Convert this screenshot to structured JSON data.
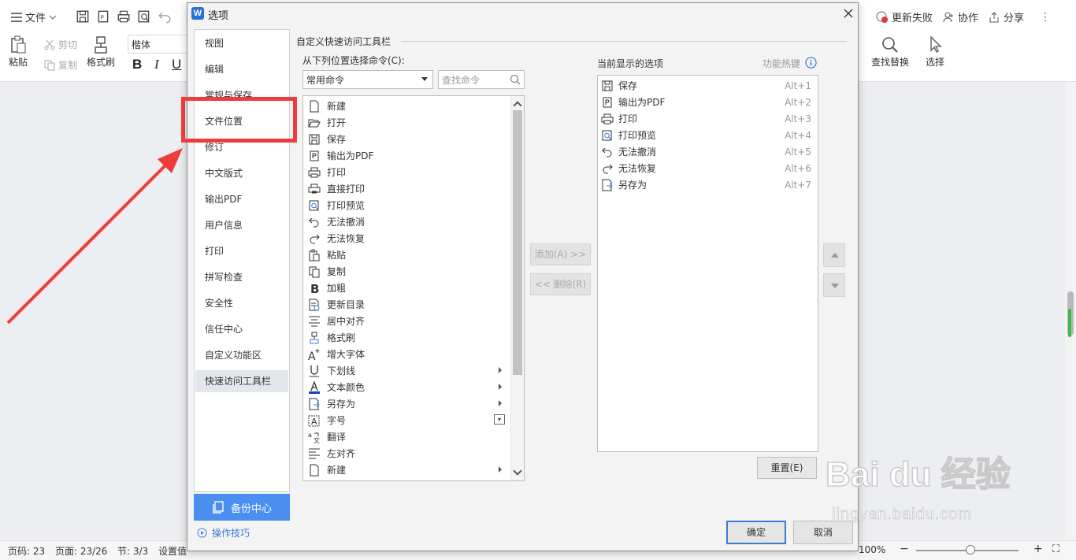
{
  "app": {
    "file_menu": "文件",
    "top_right": {
      "update_failed": "更新失败",
      "collaborate": "协作",
      "share": "分享"
    },
    "ribbon": {
      "paste": "粘贴",
      "cut": "剪切",
      "copy": "复制",
      "format_painter": "格式刷",
      "font_name": "楷体",
      "bold": "B",
      "italic": "I",
      "underline": "U",
      "find_replace": "查找替换",
      "select": "选择"
    },
    "statusbar": {
      "page_code": "页码: 23",
      "page": "页面: 23/26",
      "section": "节: 3/3",
      "setting": "设置值",
      "zoom": "100%"
    }
  },
  "dialog": {
    "title": "选项",
    "logo": "W",
    "nav_items": [
      "视图",
      "编辑",
      "常规与保存",
      "文件位置",
      "修订",
      "中文版式",
      "输出PDF",
      "用户信息",
      "打印",
      "拼写检查",
      "安全性",
      "信任中心",
      "自定义功能区",
      "快速访问工具栏"
    ],
    "selected_nav": "快速访问工具栏",
    "backup_center": "备份中心",
    "tips": "操作技巧",
    "section_title": "自定义快速访问工具栏",
    "from_label": "从下列位置选择命令(C):",
    "source_value": "常用命令",
    "search_placeholder": "查找命令",
    "commands": [
      {
        "label": "新建",
        "icon": "new-doc-icon"
      },
      {
        "label": "打开",
        "icon": "folder-open-icon"
      },
      {
        "label": "保存",
        "icon": "save-icon"
      },
      {
        "label": "输出为PDF",
        "icon": "pdf-export-icon"
      },
      {
        "label": "打印",
        "icon": "print-icon"
      },
      {
        "label": "直接打印",
        "icon": "direct-print-icon"
      },
      {
        "label": "打印预览",
        "icon": "print-preview-icon"
      },
      {
        "label": "无法撤消",
        "icon": "undo-icon"
      },
      {
        "label": "无法恢复",
        "icon": "redo-icon"
      },
      {
        "label": "粘贴",
        "icon": "paste-icon"
      },
      {
        "label": "复制",
        "icon": "copy-icon"
      },
      {
        "label": "加粗",
        "icon": "bold-icon"
      },
      {
        "label": "更新目录",
        "icon": "update-toc-icon"
      },
      {
        "label": "居中对齐",
        "icon": "align-center-icon"
      },
      {
        "label": "格式刷",
        "icon": "format-painter-icon"
      },
      {
        "label": "增大字体",
        "icon": "grow-font-icon"
      },
      {
        "label": "下划线",
        "icon": "underline-icon"
      },
      {
        "label": "文本颜色",
        "icon": "text-color-icon"
      },
      {
        "label": "另存为",
        "icon": "save-as-icon"
      },
      {
        "label": "字号",
        "icon": "font-size-icon"
      },
      {
        "label": "翻译",
        "icon": "translate-icon"
      },
      {
        "label": "左对齐",
        "icon": "align-left-icon"
      },
      {
        "label": "新建",
        "icon": "new-doc-icon"
      }
    ],
    "add_button": "添加(A) >>",
    "remove_button": "<< 删除(R)",
    "current_label": "当前显示的选项",
    "hotkey_label": "功能热键",
    "current_items": [
      {
        "label": "保存",
        "key": "Alt+1",
        "icon": "save-icon"
      },
      {
        "label": "输出为PDF",
        "key": "Alt+2",
        "icon": "pdf-export-icon"
      },
      {
        "label": "打印",
        "key": "Alt+3",
        "icon": "print-icon"
      },
      {
        "label": "打印预览",
        "key": "Alt+4",
        "icon": "print-preview-icon"
      },
      {
        "label": "无法撤消",
        "key": "Alt+5",
        "icon": "undo-icon"
      },
      {
        "label": "无法恢复",
        "key": "Alt+6",
        "icon": "redo-icon"
      },
      {
        "label": "另存为",
        "key": "Alt+7",
        "icon": "save-as-icon"
      }
    ],
    "reset_button": "重置(E)",
    "ok_button": "确定",
    "cancel_button": "取消"
  },
  "watermark": {
    "logo": "Bai du 经验",
    "url": "jingyan.baidu.com"
  },
  "colors": {
    "annotation_red": "#ee3b3b",
    "accent_blue": "#4a8ef0"
  }
}
